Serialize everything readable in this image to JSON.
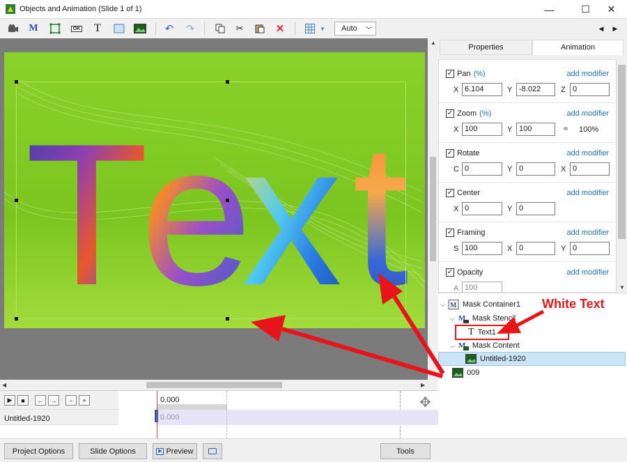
{
  "window": {
    "title": "Objects and Animation (Slide 1 of 1)",
    "minimize_glyph": "—",
    "maximize_glyph": "☐",
    "close_glyph": "✕"
  },
  "toolbar": {
    "icons": [
      "camera-icon",
      "mask-icon",
      "frame-icon",
      "ok-button-icon",
      "text-icon",
      "rectangle-icon",
      "image-icon",
      "undo-icon",
      "redo-icon",
      "copy-icon",
      "cut-icon",
      "paste-icon",
      "delete-icon",
      "grid-icon"
    ],
    "ok_label": "OK",
    "text_glyph": "T",
    "mask_glyph": "M",
    "zoom_value": "Auto",
    "nav_prev": "◀",
    "nav_next": "▶"
  },
  "slide": {
    "text": "Text",
    "background_color": "#7ed321"
  },
  "panel": {
    "tabs": [
      "Properties",
      "Animation"
    ],
    "active_tab": "Animation",
    "add_modifier": "add modifier",
    "sections": [
      {
        "title": "Pan",
        "unit": "(%)",
        "checked": true,
        "fields": [
          {
            "label": "X",
            "value": "6.104"
          },
          {
            "label": "Y",
            "value": "-8.022"
          },
          {
            "label": "Z",
            "value": "0"
          }
        ]
      },
      {
        "title": "Zoom",
        "unit": "(%)",
        "checked": true,
        "fields": [
          {
            "label": "X",
            "value": "100"
          },
          {
            "label": "Y",
            "value": "100"
          }
        ],
        "extra": "100%"
      },
      {
        "title": "Rotate",
        "unit": "",
        "checked": true,
        "fields": [
          {
            "label": "C",
            "value": "0"
          },
          {
            "label": "Y",
            "value": "0"
          },
          {
            "label": "X",
            "value": "0"
          }
        ]
      },
      {
        "title": "Center",
        "unit": "",
        "checked": true,
        "fields": [
          {
            "label": "X",
            "value": "0"
          },
          {
            "label": "Y",
            "value": "0"
          }
        ]
      },
      {
        "title": "Framing",
        "unit": "",
        "checked": true,
        "fields": [
          {
            "label": "S",
            "value": "100"
          },
          {
            "label": "X",
            "value": "0"
          },
          {
            "label": "Y",
            "value": "0"
          }
        ]
      },
      {
        "title": "Opacity",
        "unit": "",
        "checked": true,
        "fields": [
          {
            "label": "A",
            "value": "100"
          }
        ]
      }
    ]
  },
  "tree": {
    "items": [
      {
        "label": "Mask Container1",
        "icon": "mask-container-icon"
      },
      {
        "label": "Mask Stencil",
        "icon": "mask-stencil-icon"
      },
      {
        "label": "Text1",
        "icon": "text-icon"
      },
      {
        "label": "Mask Content",
        "icon": "mask-content-icon"
      },
      {
        "label": "Untitled-1920",
        "icon": "image-icon"
      },
      {
        "label": "009",
        "icon": "image-icon"
      }
    ]
  },
  "timeline": {
    "time_label": "0.000",
    "track_label": "Untitled-1920",
    "track_time": "0.000",
    "buttons": [
      "▶",
      "■",
      "←",
      "→",
      "−",
      "+"
    ]
  },
  "bottom": {
    "project_options": "Project Options",
    "slide_options": "Slide Options",
    "preview": "Preview",
    "tools": "Tools"
  },
  "annotation": {
    "label": "White Text",
    "color": "#e8141a"
  }
}
